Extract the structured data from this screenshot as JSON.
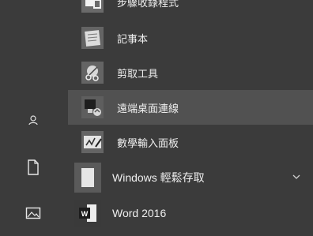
{
  "start_menu": {
    "apps": [
      {
        "label": "步驟收錄程式",
        "icon": "steps-recorder-icon"
      },
      {
        "label": "記事本",
        "icon": "notepad-icon"
      },
      {
        "label": "剪取工具",
        "icon": "snipping-tool-icon"
      },
      {
        "label": "遠端桌面連線",
        "icon": "remote-desktop-icon"
      },
      {
        "label": "數學輸入面板",
        "icon": "math-input-panel-icon"
      },
      {
        "label": "Windows 輕鬆存取",
        "icon": "folder-icon",
        "expandable": true
      },
      {
        "label": "Word 2016",
        "icon": "word-icon"
      }
    ],
    "rail": [
      "user-icon",
      "documents-icon",
      "pictures-icon"
    ]
  }
}
